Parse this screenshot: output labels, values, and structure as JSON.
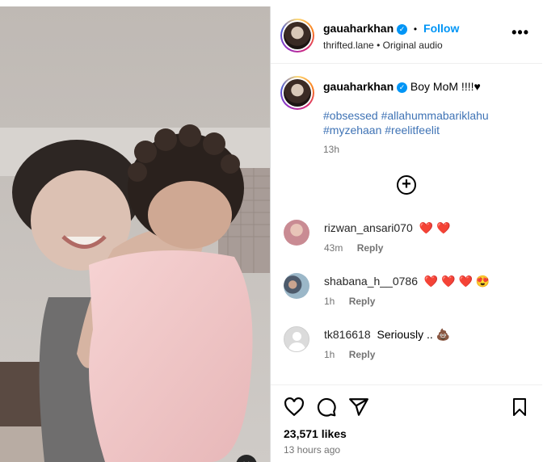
{
  "post": {
    "author": "gauaharkhan",
    "follow_label": "Follow",
    "separator": "•",
    "audio_owner": "thrifted.lane",
    "audio_sep": "•",
    "audio_label": "Original audio",
    "caption": "Boy MoM !!!!♥",
    "hashtags_line1": "#obsessed #allahummabariklahu",
    "hashtags_line2": "#myzehaan #reelitfeelit",
    "caption_time": "13h",
    "likes": "23,571 likes",
    "posted_ago": "13 hours ago"
  },
  "comments": [
    {
      "user": "rizwan_ansari070",
      "text": "❤️ ❤️",
      "time": "43m",
      "reply": "Reply"
    },
    {
      "user": "shabana_h__0786",
      "text": "❤️ ❤️ ❤️ 😍",
      "time": "1h",
      "reply": "Reply"
    },
    {
      "user": "tk816618",
      "text": "Seriously .. 💩",
      "time": "1h",
      "reply": "Reply"
    }
  ],
  "icons": {
    "verified": "verified-badge-icon",
    "more": "more-options-icon",
    "add_comment": "add-circle-icon",
    "like": "heart-icon",
    "comment": "comment-icon",
    "share": "send-icon",
    "save": "bookmark-icon",
    "mute": "mute-icon"
  },
  "colors": {
    "link_blue": "#0095f6",
    "hashtag": "#3f73b5",
    "heart_red": "#ed1f34",
    "muted_text": "#737373"
  }
}
